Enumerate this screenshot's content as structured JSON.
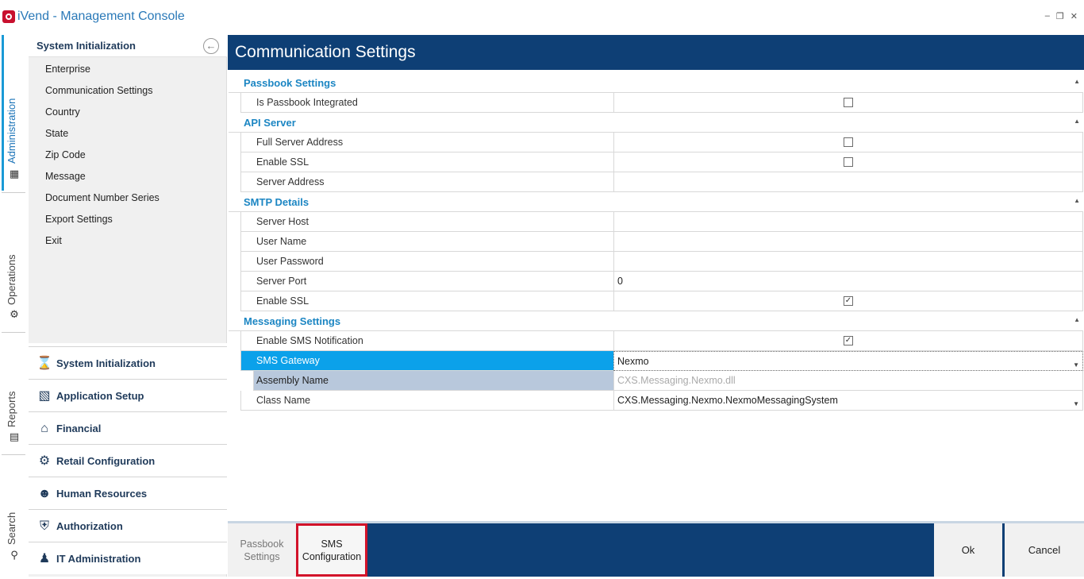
{
  "window": {
    "title": "iVend - Management Console"
  },
  "left_tabs": [
    "Administration",
    "Operations",
    "Reports",
    "Search"
  ],
  "sidebar": {
    "header": "System Initialization",
    "items": [
      "Enterprise",
      "Communication Settings",
      "Country",
      "State",
      "Zip Code",
      "Message",
      "Document Number Series",
      "Export Settings",
      "Exit"
    ],
    "modules": [
      "System Initialization",
      "Application Setup",
      "Financial",
      "Retail Configuration",
      "Human Resources",
      "Authorization",
      "IT Administration"
    ]
  },
  "main": {
    "title": "Communication Settings",
    "sections": [
      {
        "title": "Passbook Settings",
        "rows": [
          {
            "label": "Is Passbook Integrated"
          }
        ]
      },
      {
        "title": "API Server",
        "rows": [
          {
            "label": "Full Server Address"
          },
          {
            "label": "Enable SSL"
          },
          {
            "label": "Server Address"
          }
        ]
      },
      {
        "title": "SMTP Details",
        "rows": [
          {
            "label": "Server Host"
          },
          {
            "label": "User Name"
          },
          {
            "label": "User Password"
          },
          {
            "label": "Server Port",
            "value": "0"
          },
          {
            "label": "Enable SSL"
          }
        ]
      },
      {
        "title": "Messaging Settings",
        "rows": [
          {
            "label": "Enable SMS Notification"
          },
          {
            "label": "SMS Gateway",
            "value": "Nexmo"
          },
          {
            "label": "Assembly Name",
            "value": "CXS.Messaging.Nexmo.dll"
          },
          {
            "label": "Class Name",
            "value": "CXS.Messaging.Nexmo.NexmoMessagingSystem"
          }
        ]
      }
    ],
    "checkbox_states": {
      "passbook_integrated": false,
      "api_full_server_address": false,
      "api_enable_ssl": false,
      "smtp_enable_ssl": true,
      "sms_notification": true
    }
  },
  "bottom": {
    "tabs": [
      "Passbook\nSettings",
      "SMS\nConfiguration"
    ],
    "ok_label": "Ok",
    "cancel_label": "Cancel"
  },
  "colors": {
    "accent": "#0e3f75",
    "selection": "#0ba1ea",
    "highlight_border": "#d2132a"
  }
}
